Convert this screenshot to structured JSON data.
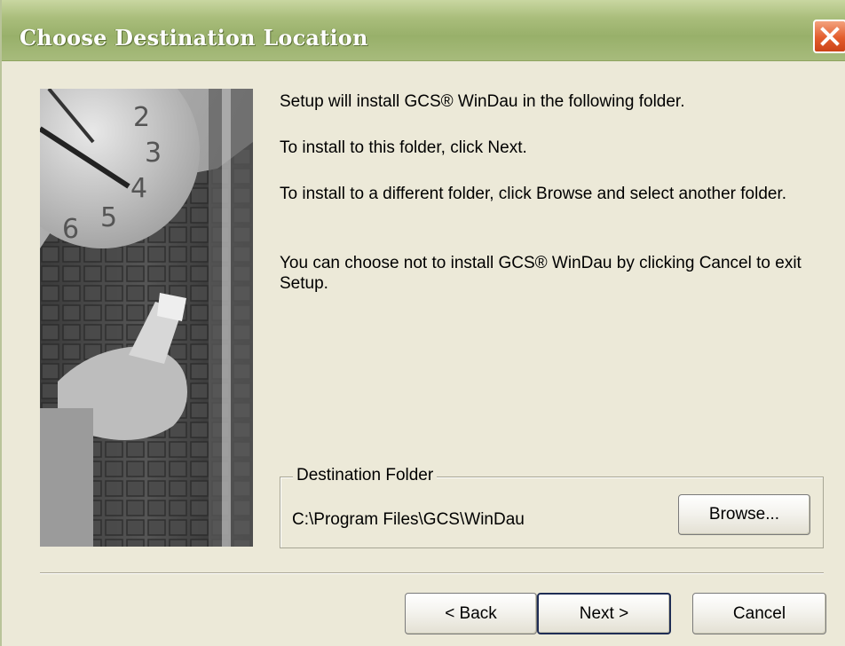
{
  "window": {
    "title": "Choose Destination Location",
    "close_icon": "close-icon"
  },
  "content": {
    "line1": "Setup will install GCS® WinDau in the following folder.",
    "line2": "To install to this folder, click Next.",
    "line3": "To install to a different folder, click Browse and select another folder.",
    "line4": "You can choose not to install GCS® WinDau by clicking Cancel to exit Setup."
  },
  "destination": {
    "group_label": "Destination Folder",
    "path": "C:\\Program Files\\GCS\\WinDau",
    "browse_label": "Browse..."
  },
  "footer": {
    "back_label": "< Back",
    "next_label": "Next >",
    "cancel_label": "Cancel"
  },
  "colors": {
    "titlebar": "#a9bd7b",
    "dialog_bg": "#ece9d8",
    "close_button": "#e35d2d"
  }
}
